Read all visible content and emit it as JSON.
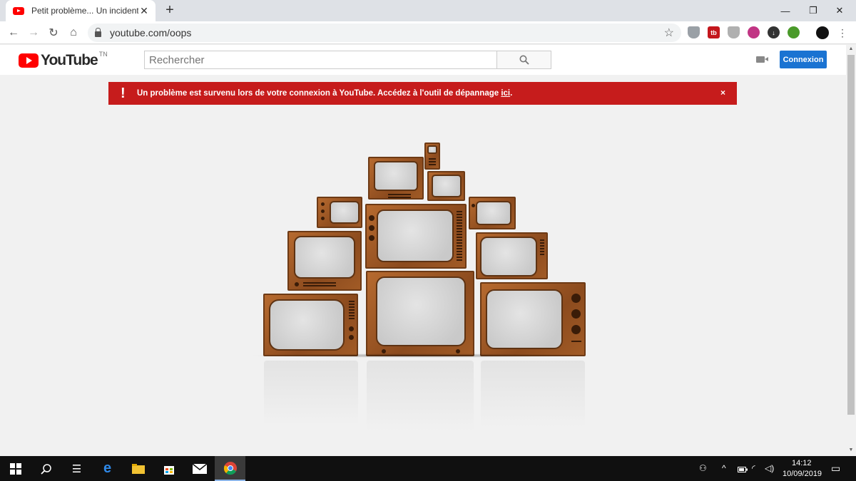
{
  "browser": {
    "tab_title": "Petit problème... Un incident est",
    "new_tab": "+",
    "url": "youtube.com/oops"
  },
  "youtube": {
    "logo_text": "YouTube",
    "logo_suffix": "TN",
    "search_placeholder": "Rechercher",
    "signin_label": "Connexion"
  },
  "alert": {
    "icon": "!",
    "message": "Un problème est survenu lors de votre connexion à YouTube. Accédez à l'outil de dépannage ",
    "link_text": "ici",
    "end": ".",
    "close": "×"
  },
  "taskbar": {
    "time": "14:12",
    "date": "10/09/2019"
  },
  "colors": {
    "alert_bg": "#c61c1c",
    "signin_bg": "#1a73d2",
    "youtube_red": "#ff0000",
    "tv_wood": "#a15b26"
  }
}
